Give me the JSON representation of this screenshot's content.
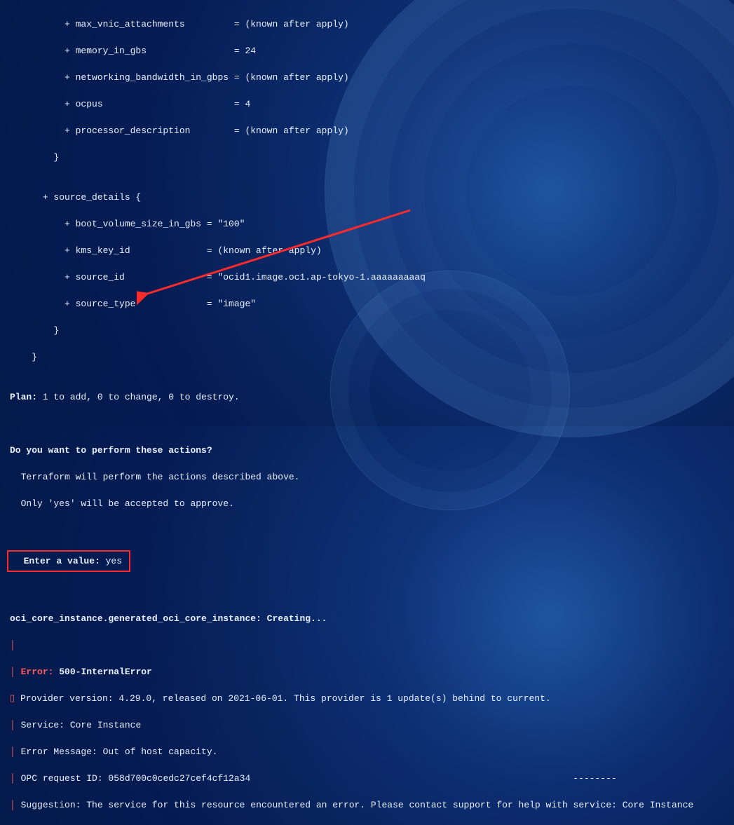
{
  "output": {
    "shape_lines": [
      "          + max_vnic_attachments         = (known after apply)",
      "          + memory_in_gbs                = 24",
      "          + networking_bandwidth_in_gbps = (known after apply)",
      "          + ocpus                        = 4",
      "          + processor_description        = (known after apply)",
      "        }",
      "",
      "      + source_details {",
      "          + boot_volume_size_in_gbs = \"100\"",
      "          + kms_key_id              = (known after apply)",
      "          + source_id               = \"ocid1.image.oc1.ap-tokyo-1.aaaaaaaaaq",
      "          + source_type             = \"image\"",
      "        }",
      "    }",
      ""
    ],
    "plan_label": "Plan:",
    "plan_text": " 1 to add, 0 to change, 0 to destroy.",
    "confirm_heading": "Do you want to perform these actions?",
    "confirm_l1": "  Terraform will perform the actions described above.",
    "confirm_l2": "  Only 'yes' will be accepted to approve.",
    "enter_label": "  Enter a value: ",
    "enter_value": "yes",
    "creating": "oci_core_instance.generated_oci_core_instance: Creating...",
    "error_word": "Error:",
    "error_code": " 500-InternalError",
    "provider_l1": " Provider version: 4.29.0, released on 2021-06-01. This provider is 1 update(s) behind to current.",
    "provider_l2": " Service: Core Instance",
    "provider_l3": " Error Message: Out of host capacity.",
    "provider_l4": " OPC request ID: 058d700c0cedc27cef4cf12a34",
    "provider_l4_tail": "--------",
    "provider_l5": " Suggestion: The service for this resource encountered an error. Please contact support for help with service: Core Instance"
  }
}
